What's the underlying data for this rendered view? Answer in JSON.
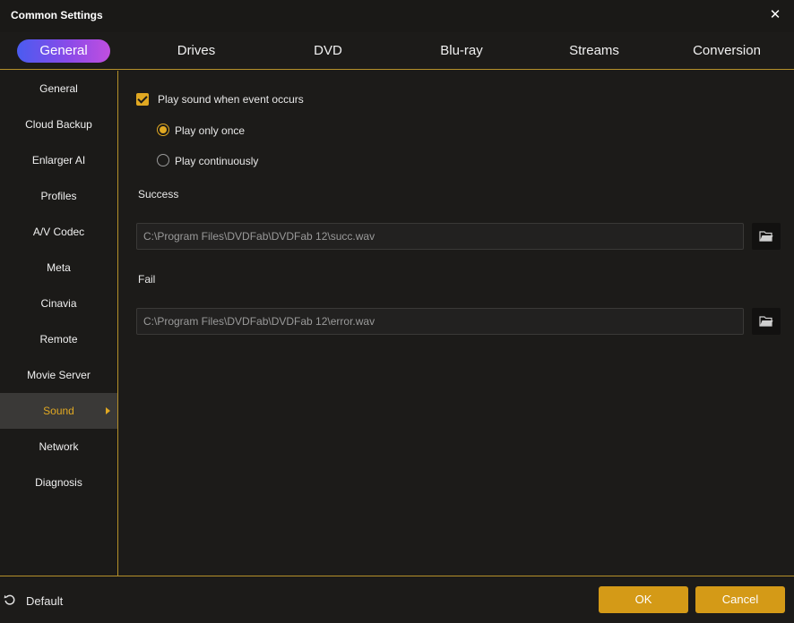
{
  "window": {
    "title": "Common Settings",
    "close_glyph": "✕"
  },
  "tabs": [
    {
      "label": "General",
      "active": true
    },
    {
      "label": "Drives"
    },
    {
      "label": "DVD"
    },
    {
      "label": "Blu-ray"
    },
    {
      "label": "Streams"
    },
    {
      "label": "Conversion"
    }
  ],
  "sidebar": {
    "items": [
      {
        "label": "General"
      },
      {
        "label": "Cloud Backup"
      },
      {
        "label": "Enlarger AI"
      },
      {
        "label": "Profiles"
      },
      {
        "label": "A/V Codec"
      },
      {
        "label": "Meta"
      },
      {
        "label": "Cinavia"
      },
      {
        "label": "Remote"
      },
      {
        "label": "Movie Server"
      },
      {
        "label": "Sound",
        "active": true
      },
      {
        "label": "Network"
      },
      {
        "label": "Diagnosis"
      }
    ]
  },
  "sound": {
    "play_sound_label": "Play sound when event occurs",
    "play_sound_checked": true,
    "play_once_label": "Play only once",
    "play_continuously_label": "Play continuously",
    "selected_mode": "once",
    "success_label": "Success",
    "success_path": "C:\\Program Files\\DVDFab\\DVDFab 12\\succ.wav",
    "fail_label": "Fail",
    "fail_path": "C:\\Program Files\\DVDFab\\DVDFab 12\\error.wav"
  },
  "footer": {
    "default_label": "Default",
    "ok_label": "OK",
    "cancel_label": "Cancel"
  },
  "colors": {
    "accent": "#e0a822",
    "button": "#d49a17",
    "divider": "#b5902a",
    "background": "#1c1b19"
  },
  "icons": {
    "close": "close-icon",
    "folder": "folder-icon",
    "reset": "reset-icon",
    "check": "checkmark-icon",
    "arrow": "caret-right-icon"
  }
}
